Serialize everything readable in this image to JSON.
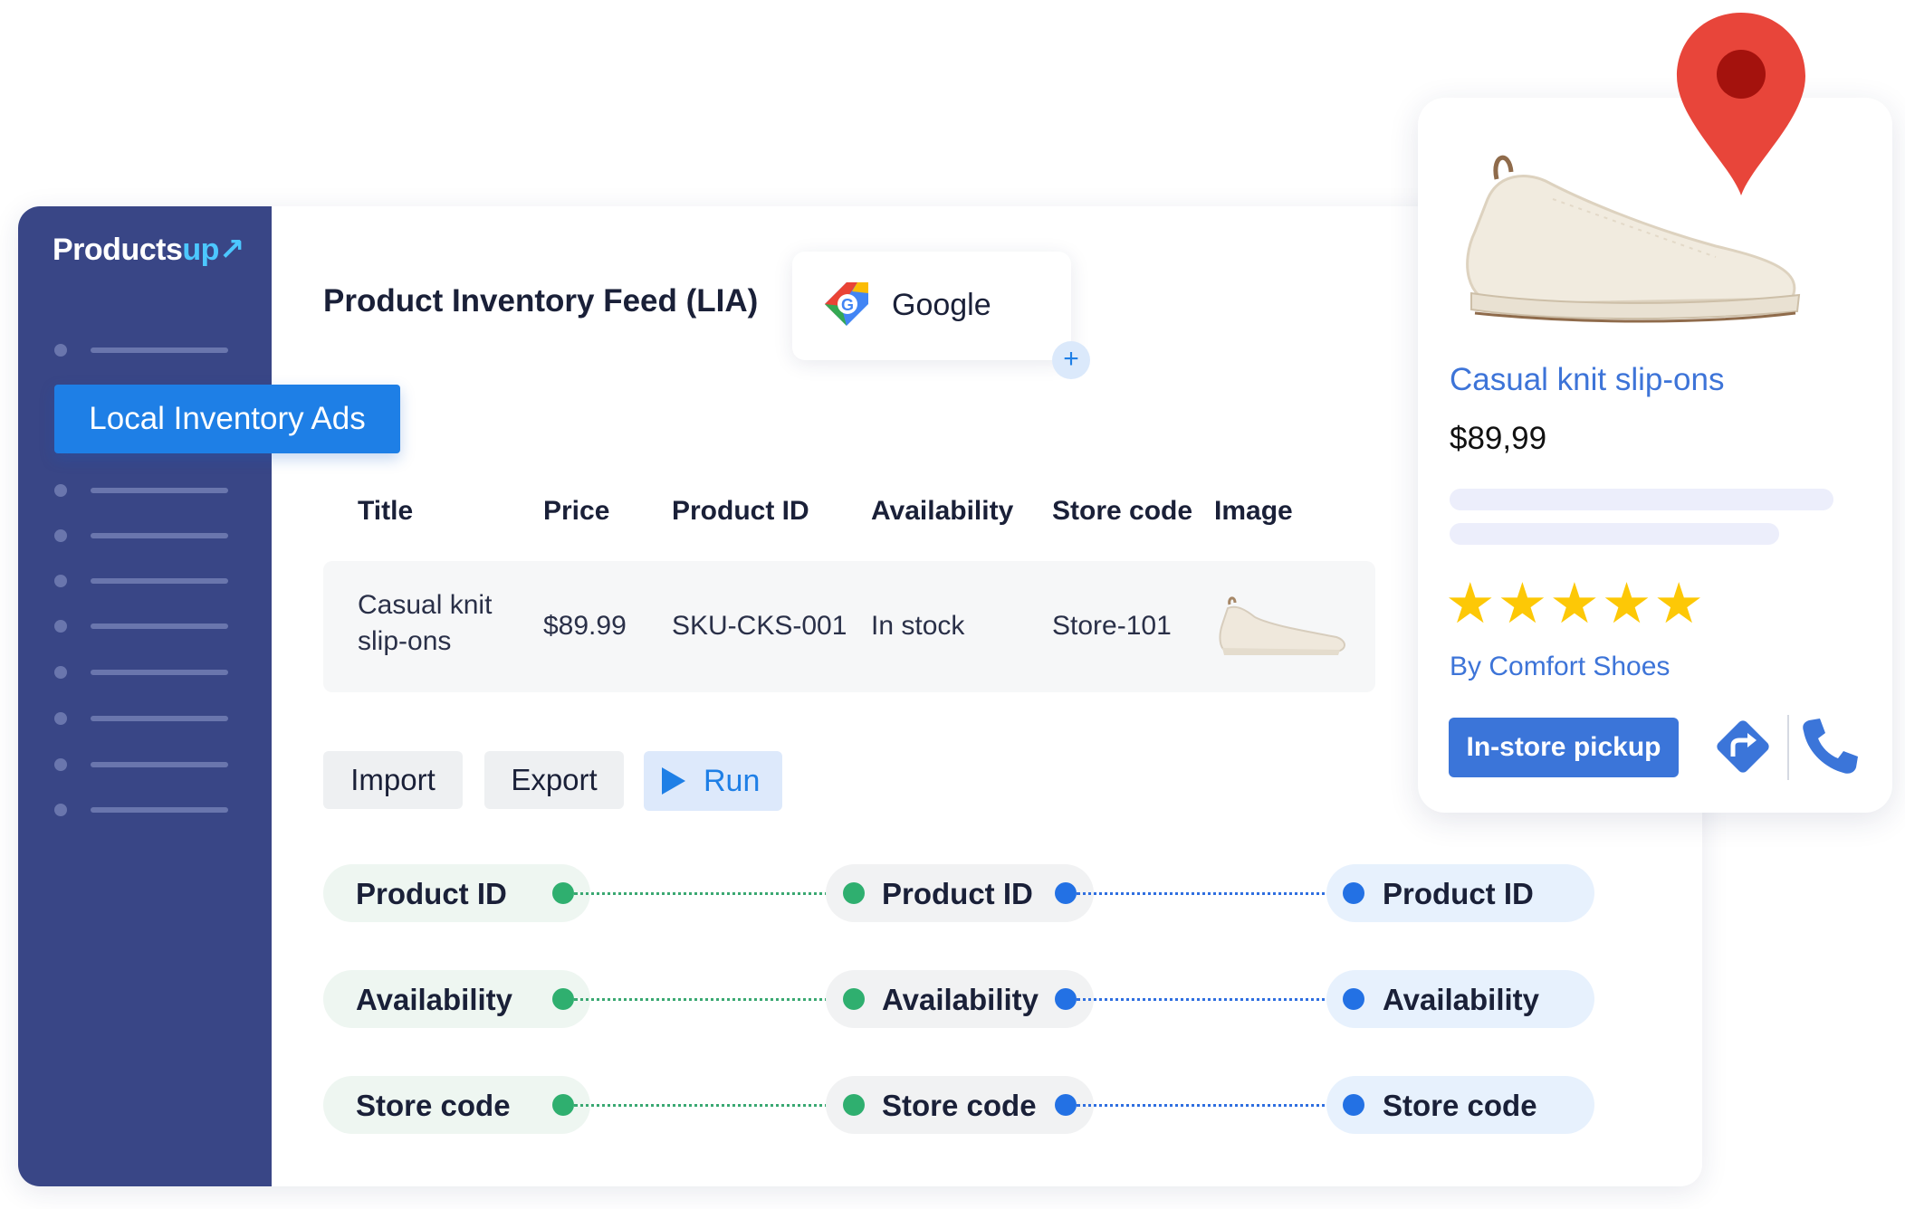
{
  "brand": {
    "name_main": "Products",
    "name_accent": "up"
  },
  "sidebar": {
    "active_item": "Local Inventory Ads"
  },
  "feed": {
    "title": "Product Inventory Feed (LIA)",
    "channel": "Google",
    "add_label": "+"
  },
  "table": {
    "headers": [
      "Title",
      "Price",
      "Product ID",
      "Availability",
      "Store code",
      "Image"
    ],
    "row": {
      "title_line1": "Casual knit",
      "title_line2": "slip-ons",
      "price": "$89.99",
      "product_id": "SKU-CKS-001",
      "availability": "In stock",
      "store_code": "Store-101"
    }
  },
  "actions": {
    "import": "Import",
    "export": "Export",
    "run": "Run"
  },
  "mapping": {
    "source": [
      "Product ID",
      "Availability",
      "Store code"
    ],
    "middle": [
      "Product ID",
      "Availability",
      "Store code"
    ],
    "target": [
      "Product ID",
      "Availability",
      "Store code"
    ]
  },
  "product_card": {
    "name": "Casual knit slip-ons",
    "price": "$89,99",
    "rating": 5,
    "stars_text": "★★★★★",
    "seller": "By Comfort Shoes",
    "pickup_label": "In-store pickup"
  },
  "colors": {
    "sidebar": "#394686",
    "accent_blue": "#1e7fe6",
    "connector_green": "#2faf6f",
    "connector_blue": "#2371e4",
    "map_pin": "#e8453a",
    "star": "#fdc806"
  }
}
